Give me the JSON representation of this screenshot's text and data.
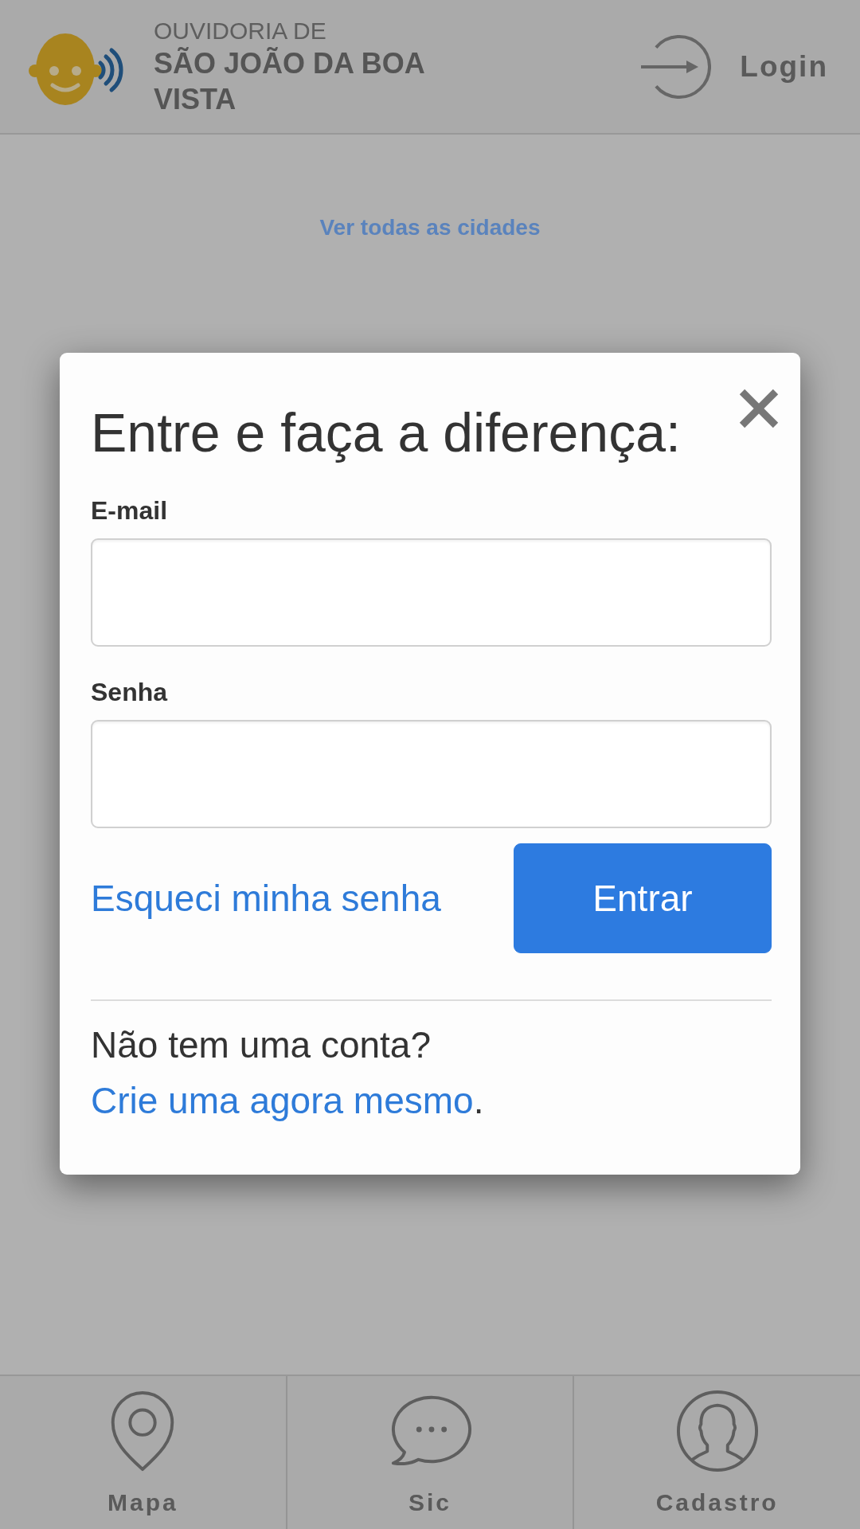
{
  "header": {
    "logo_subtitle": "OUVIDORIA DE",
    "logo_title": "SÃO JOÃO DA BOA VISTA",
    "login": "Login"
  },
  "content": {
    "link": "Ver todas as cidades"
  },
  "modal": {
    "title": "Entre e faça a diferença:",
    "fields": [
      {
        "label": "E-mail"
      },
      {
        "label": "Senha"
      }
    ],
    "forgot_link": "Esqueci minha senha",
    "submit": "Entrar",
    "signup": {
      "text": "Não tem uma conta?",
      "link": "Crie uma agora mesmo",
      "end": "."
    }
  },
  "bottom_nav": [
    {
      "label": "Mapa",
      "kind": "map"
    },
    {
      "label": "Sic",
      "kind": "chat"
    },
    {
      "label": "Cadastro",
      "kind": "profile"
    }
  ]
}
